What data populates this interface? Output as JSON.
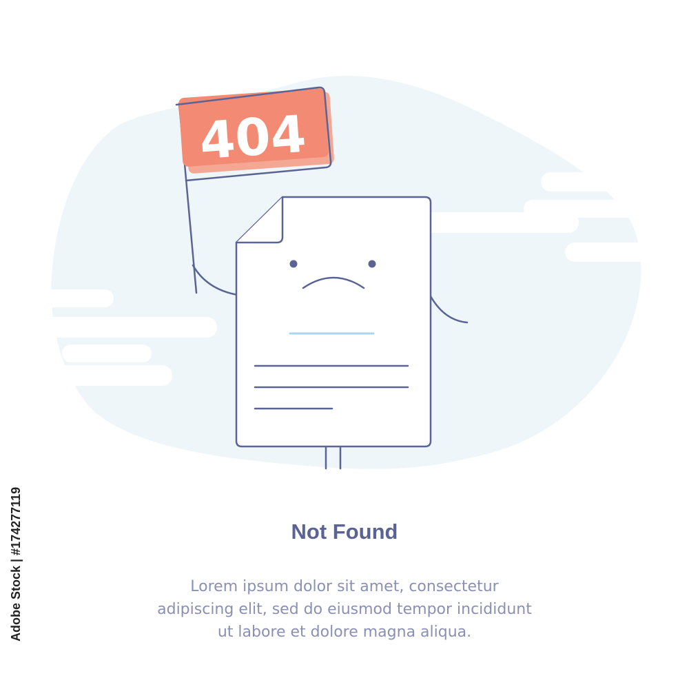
{
  "illustration": {
    "flag_text": "404"
  },
  "message": {
    "title": "Not Found",
    "line1": "Lorem ipsum dolor sit amet, consectetur",
    "line2": "adipiscing elit, sed do eiusmod tempor incididunt",
    "line3": "ut labore et dolore magna aliqua."
  },
  "watermark": {
    "text": "Adobe Stock | #174277119"
  },
  "colors": {
    "background": "#ffffff",
    "blob": "#eef6fa",
    "outline": "#5b6394",
    "flag": "#f28a74",
    "flag_shadow": "#f4a893",
    "title": "#5b6394",
    "body_text": "#8a90b4",
    "accent_line": "#a9d6ec"
  }
}
